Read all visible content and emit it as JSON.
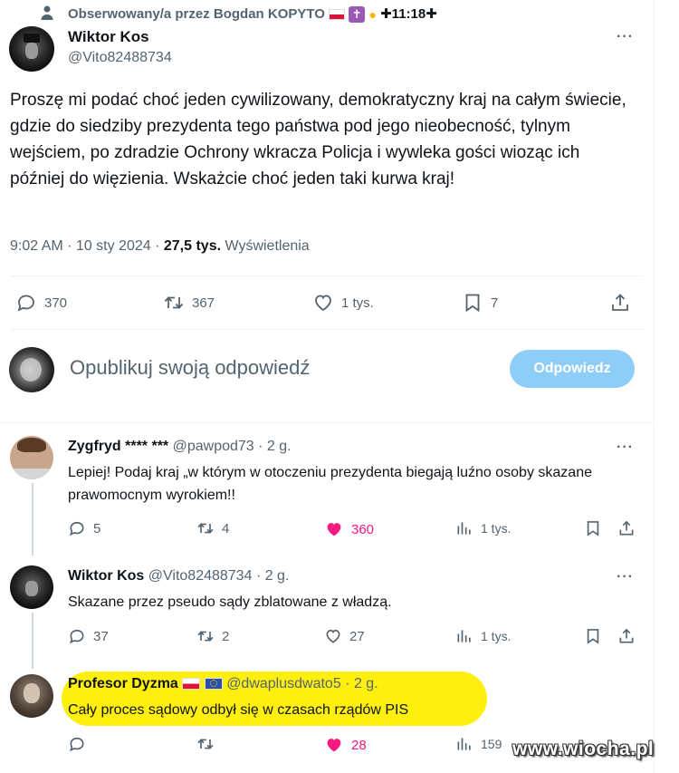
{
  "context": {
    "label": "Obserwowany/a przez Bogdan KOPYTO",
    "time_text": "✚11:18✚",
    "cross_text": "✚"
  },
  "main_tweet": {
    "author_name": "Wiktor Kos",
    "handle": "@Vito82488734",
    "text": "Proszę mi podać choć jeden cywilizowany, demokratyczny kraj na całym świecie, gdzie do siedziby prezydenta tego państwa pod jego nieobecność, tylnym wejściem, po zdradzie Ochrony wkracza Policja i wywleka gości wioząc ich później do więzienia. Wskażcie choć jeden taki kurwa kraj!",
    "time": "9:02 AM · 10 sty 2024 ·",
    "views_count": "27,5 tys.",
    "views_label": "Wyświetlenia",
    "actions": {
      "replies": "370",
      "retweets": "367",
      "likes": "1 tys.",
      "bookmarks": "7"
    }
  },
  "composer": {
    "placeholder": "Opublikuj swoją odpowiedź",
    "button_label": "Odpowiedz"
  },
  "replies": [
    {
      "author_name": "Zygfryd",
      "name_suffix": "**** ***",
      "handle": "@pawpod73",
      "age": "· 2 g.",
      "text": "Lepiej! Podaj kraj „w którym w otoczeniu  prezydenta biegają  luźno osoby skazane prawomocnym wyrokiem!!",
      "replies": "5",
      "retweets": "4",
      "likes": "360",
      "views": "1 tys."
    },
    {
      "author_name": "Wiktor Kos",
      "handle": "@Vito82488734",
      "age": "· 2 g.",
      "text": "Skazane przez pseudo sądy zblatowane z władzą.",
      "replies": "37",
      "retweets": "2",
      "likes": "27",
      "views": "1 tys."
    },
    {
      "author_name": "Profesor Dyzma",
      "handle": "@dwaplusdwato5",
      "age": "· 2 g.",
      "text": "Cały proces sądowy odbył się w czasach rządów PIS",
      "replies": "",
      "retweets": "",
      "likes": "28",
      "views": "159"
    }
  ],
  "watermark": "www.wiocha.pl",
  "colors": {
    "accent": "#1d9bf0",
    "button_disabled": "#8ecdf8",
    "like_pink": "#f91880",
    "highlight": "#ffee00",
    "text_gray": "#536471"
  }
}
